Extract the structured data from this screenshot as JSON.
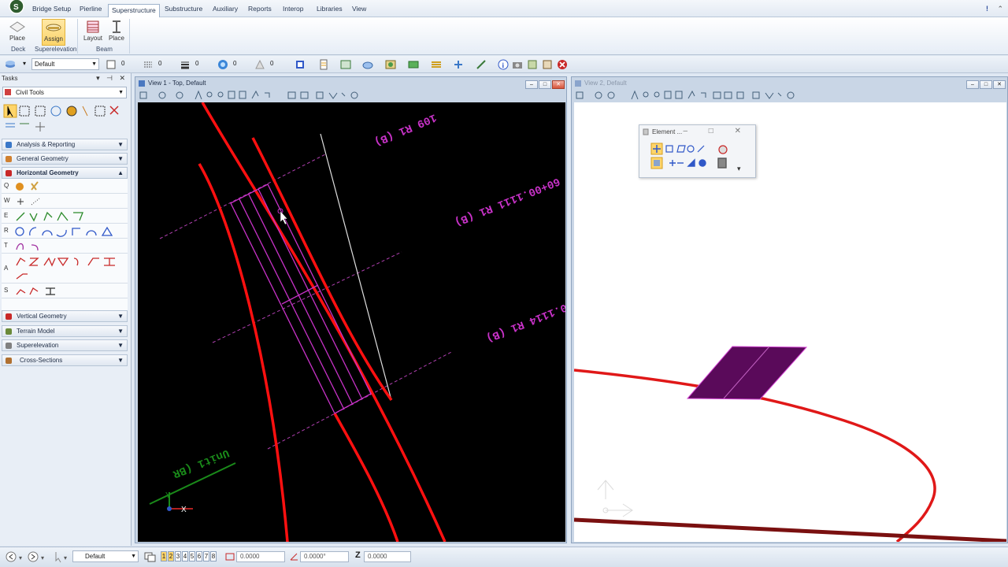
{
  "ribbon": {
    "tabs": [
      "Bridge Setup",
      "Pierline",
      "Superstructure",
      "Substructure",
      "Auxiliary",
      "Reports",
      "Interop",
      "Libraries",
      "View"
    ],
    "active_tab": "Superstructure",
    "buttons": {
      "place_deck": "Place",
      "place_deck_sub": "Deck",
      "assign": "Assign",
      "superelevation": "Superelevation",
      "layout": "Layout",
      "place_beam": "Place",
      "beam_group": "Beam"
    }
  },
  "attr_bar": {
    "level": "Default",
    "color": "0",
    "style": "0",
    "weight": "0",
    "transparency": "0",
    "priority": "0"
  },
  "tasks": {
    "title": "Tasks",
    "combo": "Civil Tools",
    "sections": [
      "Analysis & Reporting",
      "General Geometry",
      "Horizontal Geometry",
      "Vertical Geometry",
      "Terrain Model",
      "Superelevation",
      "Cross-Sections"
    ],
    "hg_keys": [
      "Q",
      "W",
      "E",
      "R",
      "T",
      "A",
      "S"
    ]
  },
  "view1": {
    "title": "View 1 - Top, Default",
    "labels": {
      "top": "109 R1 (B)",
      "upper": "60+00.1111 R1 (B)",
      "middle": "0.1114 R1 (B)",
      "unit": "Unit1 (BR"
    },
    "axis_y": "Y",
    "axis_x": "X"
  },
  "view2": {
    "title": "View 2, Default"
  },
  "palette": {
    "title": "Element ..."
  },
  "status": {
    "level": "Default",
    "view_numbers": [
      "1",
      "2",
      "3",
      "4",
      "5",
      "6",
      "7",
      "8"
    ],
    "active_views": [
      "1",
      "2"
    ],
    "dx": "0.0000",
    "angle": "0.0000°",
    "z_label": "Z",
    "z": "0.0000"
  },
  "colors": {
    "accent_red": "#ff1a1a",
    "magenta": "#c832c8",
    "deck_purple": "#5a0a5a"
  }
}
